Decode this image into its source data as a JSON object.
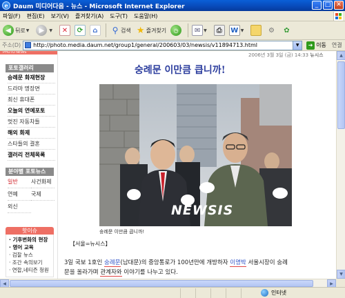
{
  "window": {
    "title": "Daum 미디어다음 - 뉴스 - Microsoft Internet Explorer"
  },
  "menu": [
    "파일(F)",
    "편집(E)",
    "보기(V)",
    "즐겨찾기(A)",
    "도구(T)",
    "도움말(H)"
  ],
  "toolbar": {
    "back_label": "뒤로",
    "search_label": "검색",
    "favorites_label": "즐겨찾기"
  },
  "address": {
    "label": "주소(D)",
    "url": "http://photo.media.daum.net/group1/general/200603/03/newsis/v11894713.html",
    "go_label": "이동",
    "links_label": "연결"
  },
  "sidebar": {
    "header": "PHOTO NEWS",
    "section1_title": "포토갤러리",
    "section1_items": [
      "숭례문 화재현장",
      "드라마 명장면",
      "최신 휴대폰",
      "오늘의 연예포토",
      "멋진 자동차들",
      "해외 화제",
      "스타들의 결혼",
      "갤러리 전체목록"
    ],
    "section2_title": "분야별 포토뉴스",
    "section2_items": [
      "일반",
      "사건화제",
      "연예",
      "국제",
      "외신"
    ],
    "section3_title": "핫이슈",
    "section3_items": [
      "· 기후변화의 현장",
      "· 영어 교육",
      "· 검찰 뉴스",
      "· 조간 속의보기",
      "· 연합,네티즌 청원"
    ]
  },
  "article": {
    "dateline": "2006년 3월 3일 (금) 14:33",
    "source_tag": "뉴시스",
    "headline": "숭례문 이만큼 큽니까!",
    "watermark": "NEWSIS",
    "caption": "숭례문 이만큼 큽니까!",
    "source": "【서울=뉴시스】",
    "body_line1_a": "3일 국보 1호인 ",
    "body_kw1": "숭례문",
    "body_line1_b": "(남대문)의 중앙통로가 100년만에 개방하자 ",
    "body_kw2": "이명박",
    "body_line1_c": " 서울시장이 숭례",
    "body_line2_a": "문을 올라가며 ",
    "body_kw3": "관계자와",
    "body_line2_b": " 이야기를 나누고 있다."
  },
  "status": {
    "zone": "인터넷"
  }
}
